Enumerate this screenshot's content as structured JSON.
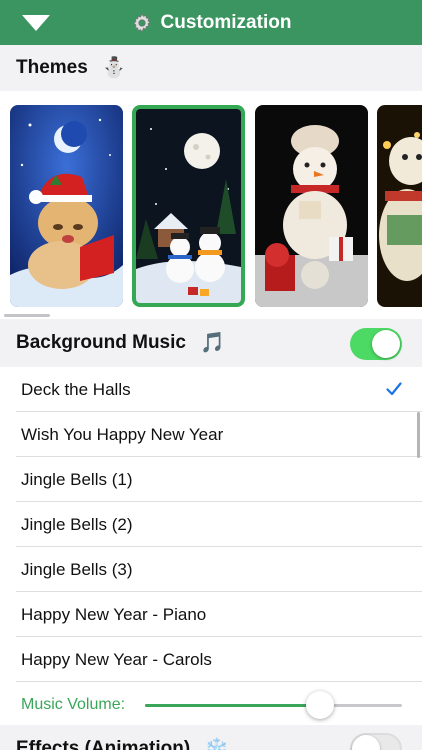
{
  "nav": {
    "title": "Customization",
    "back_icon": "triangle-down-icon",
    "title_icon": "gear-icon"
  },
  "themes": {
    "label": "Themes",
    "icon": "snowman-emoji",
    "icon_glyph": "⛄",
    "items": [
      {
        "subject": "christmas-kitten",
        "selected": false
      },
      {
        "subject": "snowmen-moon-night",
        "selected": true
      },
      {
        "subject": "plush-snowman-gifts",
        "selected": false
      },
      {
        "subject": "snowman-lights",
        "selected": false
      }
    ]
  },
  "music": {
    "label": "Background Music",
    "icon": "music-note-emoji",
    "icon_glyph": "🎵",
    "enabled": true,
    "tracks": [
      {
        "title": "Deck the Halls",
        "selected": true
      },
      {
        "title": "Wish You Happy New Year",
        "selected": false
      },
      {
        "title": "Jingle Bells (1)",
        "selected": false
      },
      {
        "title": "Jingle Bells (2)",
        "selected": false
      },
      {
        "title": "Jingle Bells (3)",
        "selected": false
      },
      {
        "title": "Happy New Year - Piano",
        "selected": false
      },
      {
        "title": "Happy New Year - Carols",
        "selected": false
      }
    ],
    "volume_label": "Music Volume:",
    "volume": 0.68
  },
  "effects": {
    "label": "Effects (Animation)",
    "icon": "snowflake-emoji",
    "icon_glyph": "❄️",
    "enabled": false
  },
  "colors": {
    "nav": "#3b9560",
    "accent": "#3aa65a",
    "toggle_on": "#4cd964",
    "check": "#1a73e8"
  }
}
